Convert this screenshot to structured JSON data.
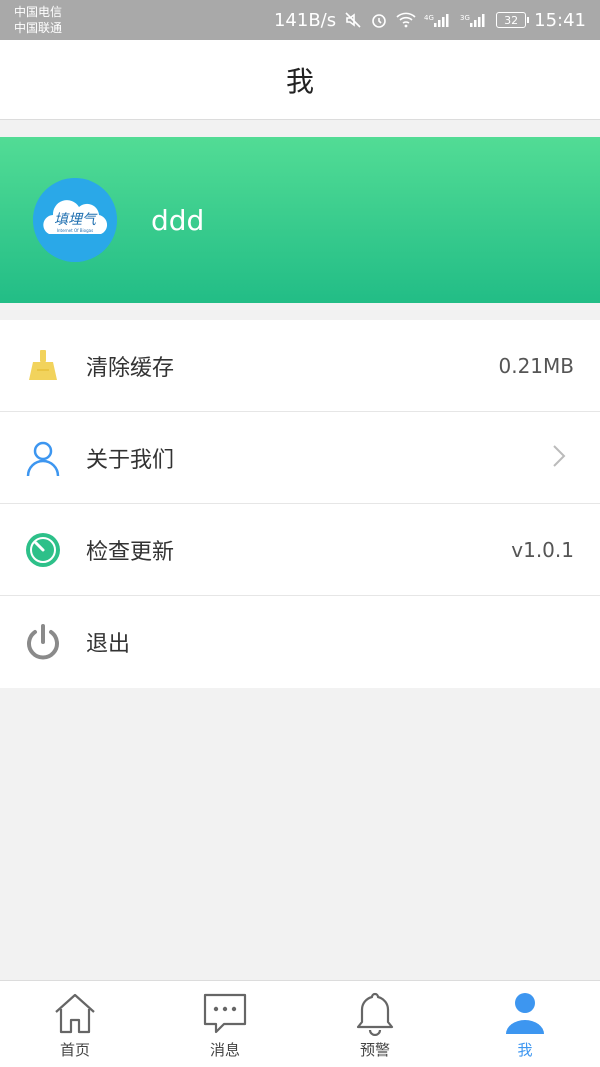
{
  "status_bar": {
    "carrier_1": "中国电信",
    "carrier_2": "中国联通",
    "speed": "141B/s",
    "battery": "32",
    "time": "15:41"
  },
  "header": {
    "title": "我"
  },
  "profile": {
    "username": "ddd",
    "avatar_text": "填埋气",
    "avatar_subtext": "Internet Of Biogas"
  },
  "menu": {
    "items": [
      {
        "label": "清除缓存",
        "value": "0.21MB",
        "icon": "broom-icon"
      },
      {
        "label": "关于我们",
        "icon": "person-icon"
      },
      {
        "label": "检查更新",
        "value": "v1.0.1",
        "icon": "timer-icon"
      },
      {
        "label": "退出",
        "icon": "power-icon"
      }
    ]
  },
  "tabs": [
    {
      "label": "首页",
      "icon": "home-icon"
    },
    {
      "label": "消息",
      "icon": "message-icon"
    },
    {
      "label": "预警",
      "icon": "bell-icon"
    },
    {
      "label": "我",
      "icon": "user-icon",
      "active": true
    }
  ],
  "colors": {
    "accent": "#3d96f0",
    "banner_top": "#52dc95",
    "banner_bottom": "#22bd86",
    "broom": "#f2d35c",
    "timer": "#2dc089"
  }
}
